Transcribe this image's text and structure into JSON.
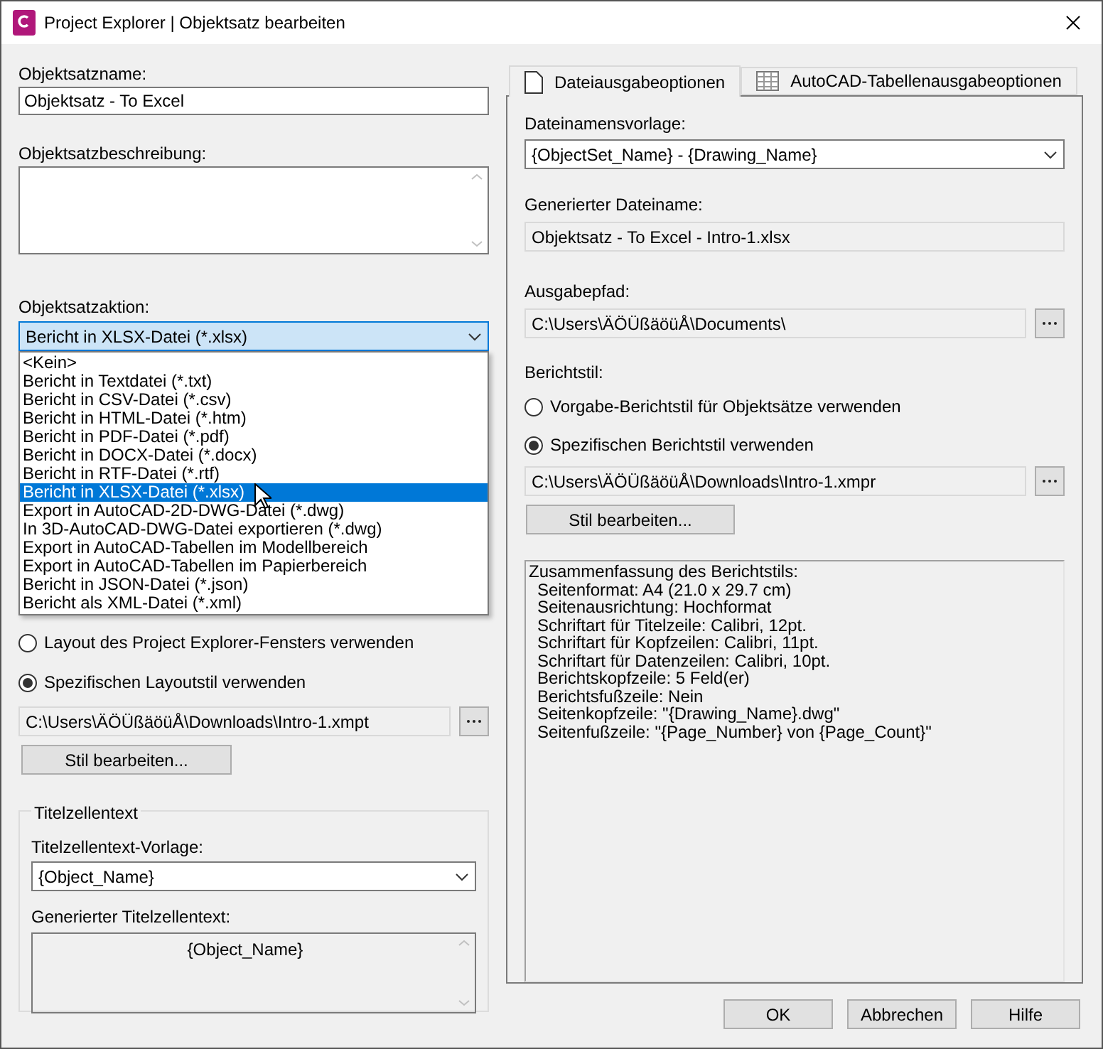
{
  "window": {
    "title": "Project Explorer | Objektsatz bearbeiten"
  },
  "left": {
    "name_field": {
      "label": "Objektsatzname:",
      "value": "Objektsatz - To Excel"
    },
    "description": {
      "label": "Objektsatzbeschreibung:"
    },
    "action": {
      "label": "Objektsatzaktion:",
      "value": "Bericht in XLSX-Datei (*.xlsx)",
      "expanded": true,
      "options": [
        {
          "label": "<Kein>",
          "selected": false
        },
        {
          "label": "Bericht in Textdatei (*.txt)",
          "selected": false
        },
        {
          "label": "Bericht in CSV-Datei (*.csv)",
          "selected": false
        },
        {
          "label": "Bericht in HTML-Datei (*.htm)",
          "selected": false
        },
        {
          "label": "Bericht in PDF-Datei (*.pdf)",
          "selected": false
        },
        {
          "label": "Bericht in DOCX-Datei (*.docx)",
          "selected": false
        },
        {
          "label": "Bericht in RTF-Datei (*.rtf)",
          "selected": false
        },
        {
          "label": "Bericht in XLSX-Datei (*.xlsx)",
          "selected": true
        },
        {
          "label": "Export in AutoCAD-2D-DWG-Datei (*.dwg)",
          "selected": false
        },
        {
          "label": "In 3D-AutoCAD-DWG-Datei exportieren (*.dwg)",
          "selected": false
        },
        {
          "label": "Export in AutoCAD-Tabellen im Modellbereich",
          "selected": false
        },
        {
          "label": "Export in AutoCAD-Tabellen im Papierbereich",
          "selected": false
        },
        {
          "label": "Bericht in JSON-Datei (*.json)",
          "selected": false
        },
        {
          "label": "Bericht als XML-Datei (*.xml)",
          "selected": false
        }
      ]
    },
    "layout_radios": [
      {
        "label": "Layout des Project Explorer-Fensters verwenden",
        "selected": false
      },
      {
        "label": "Spezifischen Layoutstil verwenden",
        "selected": true
      }
    ],
    "layout_path": "C:\\Users\\ÄÖÜßäöüÅ\\Downloads\\Intro-1.xmpt",
    "edit_style_button": "Stil bearbeiten...",
    "title_group": {
      "legend": "Titelzellentext",
      "template_label": "Titelzellentext-Vorlage:",
      "template_value": "{Object_Name}",
      "generated_label": "Generierter Titelzellentext:",
      "generated_value": "{Object_Name}"
    }
  },
  "right": {
    "tabs": [
      {
        "label": "Dateiausgabeoptionen",
        "kind": "document",
        "selected": true
      },
      {
        "label": "AutoCAD-Tabellenausgabeoptionen",
        "kind": "table",
        "selected": false
      }
    ],
    "filename_template": {
      "label": "Dateinamensvorlage:",
      "value": "{ObjectSet_Name} - {Drawing_Name}"
    },
    "generated_filename": {
      "label": "Generierter Dateiname:",
      "value": "Objektsatz - To Excel - Intro-1.xlsx"
    },
    "output_path": {
      "label": "Ausgabepfad:",
      "value": "C:\\Users\\ÄÖÜßäöüÅ\\Documents\\"
    },
    "report_style": {
      "label": "Berichtstil:",
      "radios": [
        {
          "label": "Vorgabe-Berichtstil für Objektsätze verwenden",
          "selected": false
        },
        {
          "label": "Spezifischen Berichtstil verwenden",
          "selected": true
        }
      ],
      "path": "C:\\Users\\ÄÖÜßäöüÅ\\Downloads\\Intro-1.xmpr",
      "button": "Stil bearbeiten..."
    },
    "summary": {
      "title": "Zusammenfassung des Berichtstils:",
      "lines": [
        "Seitenformat: A4 (21.0 x 29.7 cm)",
        "Seitenausrichtung: Hochformat",
        "Schriftart für Titelzeile: Calibri, 12pt.",
        "Schriftart für Kopfzeilen: Calibri, 11pt.",
        "Schriftart für Datenzeilen: Calibri, 10pt.",
        "Berichtskopfzeile: 5 Feld(er)",
        "Berichtsfußzeile: Nein",
        "Seitenkopfzeile: \"{Drawing_Name}.dwg\"",
        "Seitenfußzeile: \"{Page_Number} von {Page_Count}\""
      ]
    }
  },
  "buttons": [
    "OK",
    "Abbrechen",
    "Hilfe"
  ]
}
